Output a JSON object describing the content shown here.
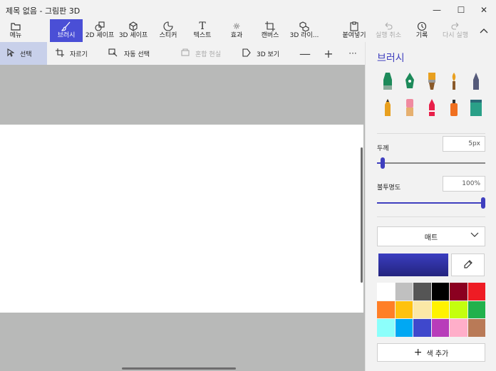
{
  "window": {
    "title": "제목 없음 - 그림판 3D",
    "minimize": "—",
    "maximize": "☐",
    "close": "✕"
  },
  "toolbar": {
    "menu": "메뉴",
    "brush": "브러시",
    "shapes2d": "2D 셰이프",
    "shapes3d": "3D 셰이프",
    "sticker": "스티커",
    "text": "텍스트",
    "effects": "효과",
    "canvas": "캔버스",
    "library3d": "3D 라이...",
    "paste": "붙여넣기",
    "undo": "실행 취소",
    "history": "기록",
    "redo": "다시 실행"
  },
  "subbar": {
    "select": "선택",
    "crop": "자르기",
    "magic_select": "자동 선택",
    "mixed_reality": "혼합 현실",
    "view3d": "3D 보기",
    "minus": "—",
    "plus": "+",
    "more": "···"
  },
  "panel": {
    "title": "브러시",
    "thickness_label": "두께",
    "thickness_value": "5px",
    "thickness_fraction": 0.04,
    "opacity_label": "불투명도",
    "opacity_value": "100%",
    "opacity_fraction": 1.0,
    "material": "매트",
    "add_color": "색 추가",
    "add_color_icon": "+",
    "current_color": "#3a3dc0",
    "brushes": [
      {
        "name": "marker",
        "color": "#1d8a5a"
      },
      {
        "name": "calligraphy-pen",
        "color": "#1d8a5a"
      },
      {
        "name": "oil-brush",
        "color": "#e8a020"
      },
      {
        "name": "watercolor",
        "color": "#e8a020"
      },
      {
        "name": "pixel-pen",
        "color": "#555a7a"
      },
      {
        "name": "pencil",
        "color": "#e8a020"
      },
      {
        "name": "eraser",
        "color": "#f08aa0"
      },
      {
        "name": "crayon",
        "color": "#e8204a"
      },
      {
        "name": "spraycan",
        "color": "#f07020"
      },
      {
        "name": "fill",
        "color": "#2aa088"
      }
    ],
    "palette": [
      "#ffffff",
      "#c0c0c0",
      "#555555",
      "#000000",
      "#8b0020",
      "#ee1c24",
      "#ff7f27",
      "#ffc20e",
      "#fbe8a6",
      "#fff200",
      "#c4ff0e",
      "#22b14c",
      "#8cfffb",
      "#00a8f3",
      "#3f48cc",
      "#b83dba",
      "#ffaec9",
      "#b97a57"
    ]
  }
}
